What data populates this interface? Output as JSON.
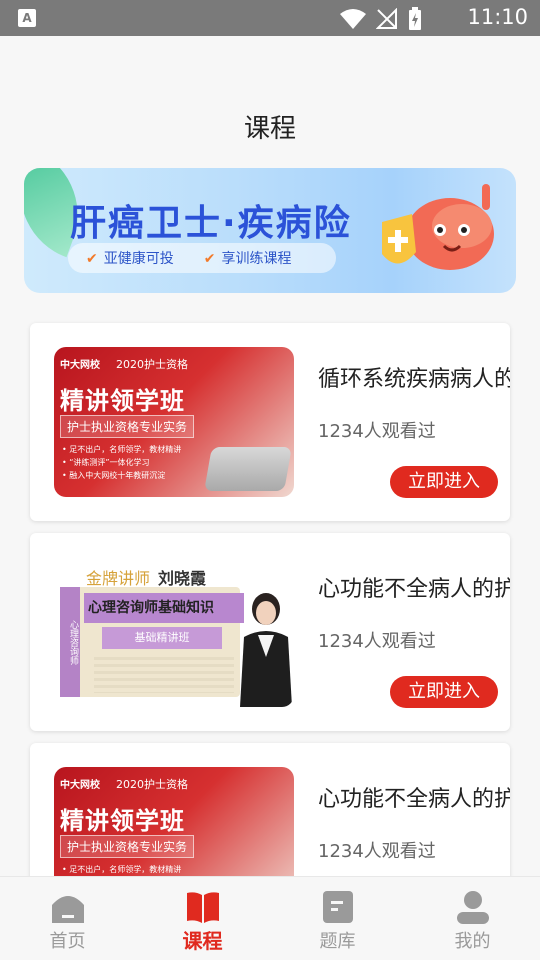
{
  "status_bar": {
    "time": "11:10",
    "app_icon_letter": "A"
  },
  "page": {
    "title": "课程"
  },
  "banner": {
    "title": "肝癌卫士·疾病险",
    "features": [
      {
        "check": "✔",
        "label": "亚健康可投"
      },
      {
        "check": "✔",
        "label": "享训练课程"
      }
    ]
  },
  "courses": [
    {
      "title": "循环系统疾病病人的",
      "views": "1234人观看过",
      "button": "立即进入",
      "thumbnail": {
        "style": "red",
        "brand": "中大网校",
        "tag": "2020护士资格",
        "headline": "精讲领学班",
        "subtitle": "护士执业资格专业实务",
        "bullets": [
          "• 足不出户，名师领学，教材精讲",
          "• “讲练测评”一体化学习",
          "• 融入中大网校十年教研沉淀"
        ]
      }
    },
    {
      "title": "心功能不全病人的护",
      "views": "1234人观看过",
      "button": "立即进入",
      "thumbnail": {
        "style": "gold",
        "gold_label": "金牌讲师",
        "teacher_name": "刘晓霞",
        "headline": "心理咨询师基础知识",
        "subtitle": "基础精讲班",
        "spine": "心理咨询师"
      }
    },
    {
      "title": "心功能不全病人的护",
      "views": "1234人观看过",
      "button": "立即进入",
      "thumbnail": {
        "style": "red",
        "brand": "中大网校",
        "tag": "2020护士资格",
        "headline": "精讲领学班",
        "subtitle": "护士执业资格专业实务",
        "bullets": [
          "• 足不出户，名师领学，教材精讲",
          "",
          ""
        ]
      }
    }
  ],
  "bottom_nav": [
    {
      "label": "首页",
      "icon": "home-icon",
      "active": false
    },
    {
      "label": "课程",
      "icon": "book-icon",
      "active": true
    },
    {
      "label": "题库",
      "icon": "question-bank-icon",
      "active": false
    },
    {
      "label": "我的",
      "icon": "profile-icon",
      "active": false
    }
  ],
  "colors": {
    "accent": "#e02a1f",
    "inactive": "#9a9a9a",
    "banner_text": "#2b52d8"
  }
}
